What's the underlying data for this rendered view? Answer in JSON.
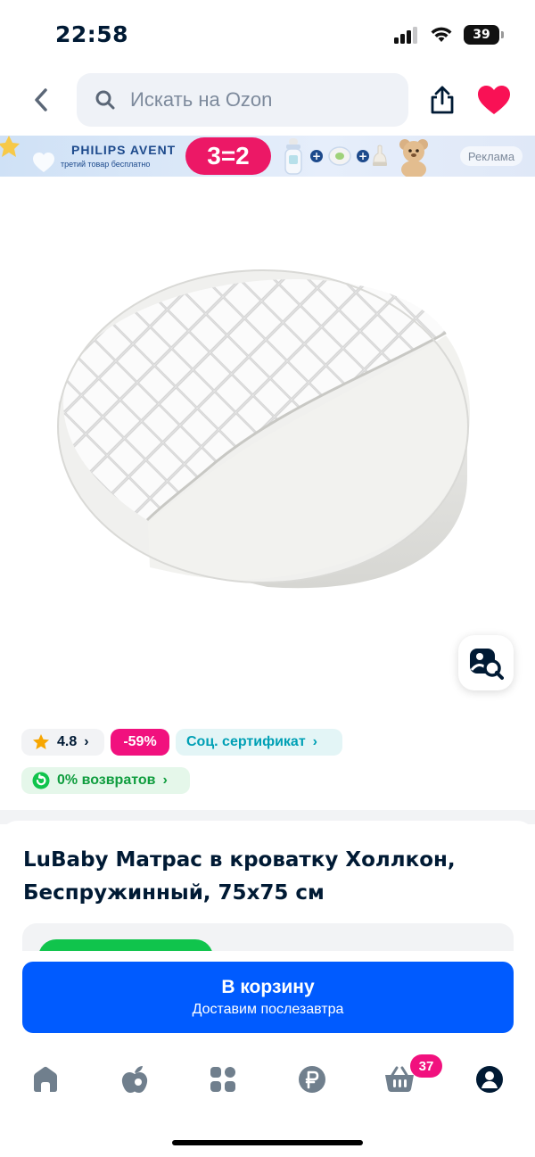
{
  "status_bar": {
    "time": "22:58",
    "battery": "39"
  },
  "search": {
    "placeholder": "Искать на Ozon"
  },
  "ad_banner": {
    "brand": "PHILIPS AVENT",
    "subtitle": "третий товар бесплатно",
    "promo": "3=2",
    "label": "Реклама"
  },
  "badges": {
    "rating": "4.8",
    "discount": "-59%",
    "certificate": "Соц. сертификат",
    "returns": "0% возвратов"
  },
  "product": {
    "title": "LuBaby Матрас в кроватку Холлкон, Беспружинный, 75х75 см"
  },
  "cta": {
    "main": "В корзину",
    "sub": "Доставим послезавтра"
  },
  "tabbar": {
    "cart_count": "37"
  },
  "colors": {
    "brand_blue": "#005bff",
    "discount_pink": "#f1117e",
    "cert_teal": "#00a0b5",
    "returns_green": "#0f9d3e",
    "favorite_red": "#f91155"
  }
}
